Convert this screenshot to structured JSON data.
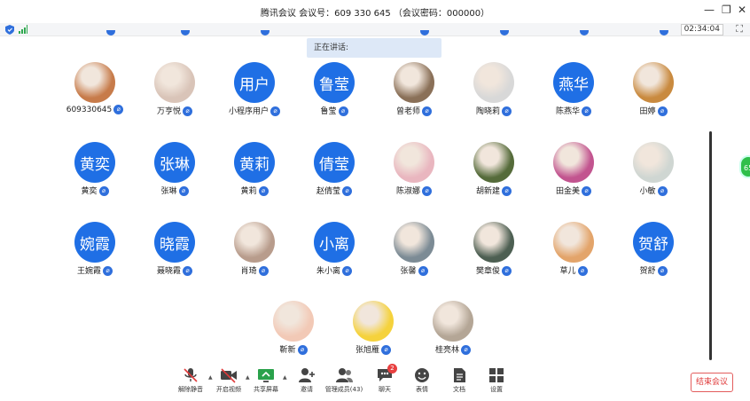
{
  "window": {
    "title": "腾讯会议 会议号：609 330 645 （会议密码：000000）"
  },
  "status": {
    "timer": "02:34:04"
  },
  "speaking": {
    "label": "正在讲话:"
  },
  "participants_row1": [
    {
      "name": "609330645",
      "avatar_text": "",
      "photo_color": "#c77b4a"
    },
    {
      "name": "万亨悦",
      "avatar_text": "",
      "photo_color": "#d9c4b8"
    },
    {
      "name": "小程序用户",
      "avatar_text": "用户",
      "photo_color": ""
    },
    {
      "name": "鲁莹",
      "avatar_text": "鲁莹",
      "photo_color": ""
    },
    {
      "name": "曾老师",
      "avatar_text": "",
      "photo_color": "#8a7058"
    },
    {
      "name": "陶晓莉",
      "avatar_text": "",
      "photo_color": "#d8d8d8"
    },
    {
      "name": "陈燕华",
      "avatar_text": "燕华",
      "photo_color": ""
    },
    {
      "name": "田婷",
      "avatar_text": "",
      "photo_color": "#c98a3f"
    }
  ],
  "participants_row2": [
    {
      "name": "黄奕",
      "avatar_text": "黄奕",
      "photo_color": ""
    },
    {
      "name": "张琳",
      "avatar_text": "张琳",
      "photo_color": ""
    },
    {
      "name": "黄莉",
      "avatar_text": "黄莉",
      "photo_color": ""
    },
    {
      "name": "赵倩莹",
      "avatar_text": "倩莹",
      "photo_color": ""
    },
    {
      "name": "陈淑娜",
      "avatar_text": "",
      "photo_color": "#e9b6bf"
    },
    {
      "name": "胡新建",
      "avatar_text": "",
      "photo_color": "#556b3a"
    },
    {
      "name": "田金美",
      "avatar_text": "",
      "photo_color": "#c2548f"
    },
    {
      "name": "小敏",
      "avatar_text": "",
      "photo_color": "#cfd6d2"
    }
  ],
  "participants_row3": [
    {
      "name": "王婉霞",
      "avatar_text": "婉霞",
      "photo_color": ""
    },
    {
      "name": "聂晓霞",
      "avatar_text": "晓霞",
      "photo_color": ""
    },
    {
      "name": "肖琦",
      "avatar_text": "",
      "photo_color": "#b89c8c"
    },
    {
      "name": "朱小离",
      "avatar_text": "小离",
      "photo_color": ""
    },
    {
      "name": "张馨",
      "avatar_text": "",
      "photo_color": "#7c8b95"
    },
    {
      "name": "樊章俊",
      "avatar_text": "",
      "photo_color": "#4d5f52"
    },
    {
      "name": "草儿",
      "avatar_text": "",
      "photo_color": "#e3a46a"
    },
    {
      "name": "贺舒",
      "avatar_text": "贺舒",
      "photo_color": ""
    }
  ],
  "participants_row4": [
    {
      "name": "靳新",
      "avatar_text": "",
      "photo_color": "#f2c9b6"
    },
    {
      "name": "张旭雁",
      "avatar_text": "",
      "photo_color": "#f5d23c"
    },
    {
      "name": "桂亮林",
      "avatar_text": "",
      "photo_color": "#b4a696"
    }
  ],
  "side_badge": "65",
  "toolbar": {
    "unmute": "解除静音",
    "video": "开启视频",
    "share": "共享屏幕",
    "invite": "邀请",
    "members": "管理成员(43)",
    "chat": "聊天",
    "chat_badge": "2",
    "emoji": "表情",
    "docs": "文档",
    "settings": "设置",
    "end": "结束会议"
  },
  "colors": {
    "accent": "#1f6fe5",
    "end_red": "#e03a3a"
  }
}
